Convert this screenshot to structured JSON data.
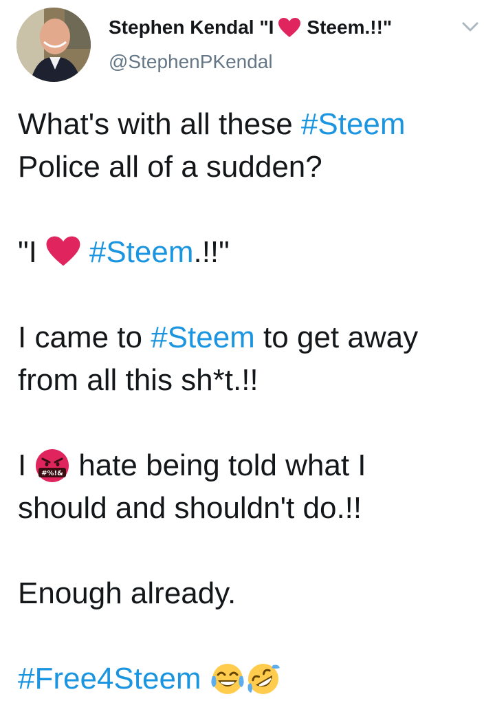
{
  "author": {
    "name_part1": "Stephen Kendal \"I",
    "name_part2": "Steem.!!\"",
    "handle": "@StephenPKendal"
  },
  "icons": {
    "avatar": "profile-photo",
    "name_heart": "red-heart-icon",
    "menu": "chevron-down-icon"
  },
  "tweet": {
    "l1_text": "What's with all these ",
    "l1_tag": "#Steem",
    "l2_text": "Police all of a sudden?",
    "l3_pre": "\"I",
    "l3_tag": "#Steem",
    "l3_post": ".!!\"",
    "l4_pre": "I came to ",
    "l4_tag": "#Steem",
    "l4_post": " to get away",
    "l5_text": "from all this sh*t.!!",
    "l6_pre": "I",
    "l6_post": "hate being told what I",
    "l7_text": "should and shouldn't do.!!",
    "l8_text": "Enough already.",
    "l9_tag": "#Free4Steem",
    "angry_emoji_label": "#%!&"
  },
  "colors": {
    "hashtag": "#1b95e0",
    "handle": "#657786",
    "heart": "#e0245e"
  }
}
